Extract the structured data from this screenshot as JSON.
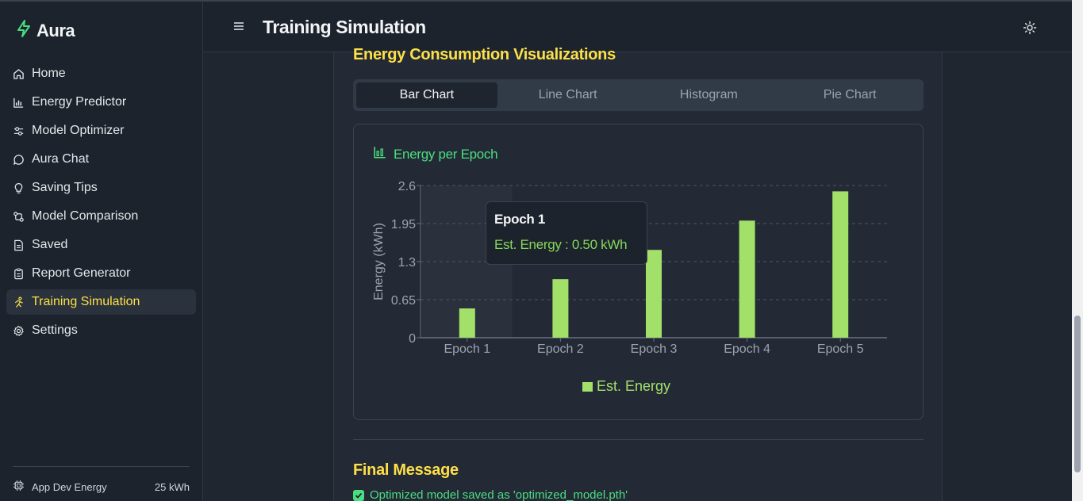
{
  "app": {
    "name": "Aura"
  },
  "header": {
    "title": "Training Simulation"
  },
  "sidebar": {
    "items": [
      {
        "label": "Home",
        "icon": "home-icon"
      },
      {
        "label": "Energy Predictor",
        "icon": "bar-chart-icon"
      },
      {
        "label": "Model Optimizer",
        "icon": "sliders-icon"
      },
      {
        "label": "Aura Chat",
        "icon": "chat-icon"
      },
      {
        "label": "Saving Tips",
        "icon": "lightbulb-icon"
      },
      {
        "label": "Model Comparison",
        "icon": "compare-icon"
      },
      {
        "label": "Saved",
        "icon": "file-icon"
      },
      {
        "label": "Report Generator",
        "icon": "clipboard-icon"
      },
      {
        "label": "Training Simulation",
        "icon": "run-icon",
        "active": true
      },
      {
        "label": "Settings",
        "icon": "gear-icon"
      }
    ],
    "footer": {
      "label": "App Dev Energy",
      "value": "25 kWh"
    }
  },
  "section": {
    "title": "Energy Consumption Visualizations"
  },
  "tabs": [
    {
      "label": "Bar Chart",
      "active": true
    },
    {
      "label": "Line Chart"
    },
    {
      "label": "Histogram"
    },
    {
      "label": "Pie Chart"
    }
  ],
  "chart_card": {
    "title": "Energy per Epoch"
  },
  "tooltip": {
    "title": "Epoch 1",
    "text": "Est. Energy : 0.50 kWh"
  },
  "chart_data": {
    "type": "bar",
    "categories": [
      "Epoch 1",
      "Epoch 2",
      "Epoch 3",
      "Epoch 4",
      "Epoch 5"
    ],
    "series": [
      {
        "name": "Est. Energy",
        "values": [
          0.5,
          1.0,
          1.5,
          2.0,
          2.5
        ],
        "color": "#a3e06a"
      }
    ],
    "ylabel": "Energy (kWh)",
    "ylim": [
      0,
      2.6
    ],
    "yticks": [
      "0",
      "0.65",
      "1.3",
      "1.95",
      "2.6"
    ],
    "yticks_values": [
      0,
      0.65,
      1.3,
      1.95,
      2.6
    ],
    "grid": true,
    "legend": "bottom"
  },
  "final": {
    "title": "Final Message",
    "message": "Optimized model saved as 'optimized_model.pth'"
  },
  "colors": {
    "accent": "#fde047",
    "success": "#4ade80",
    "bar": "#a3e06a"
  }
}
